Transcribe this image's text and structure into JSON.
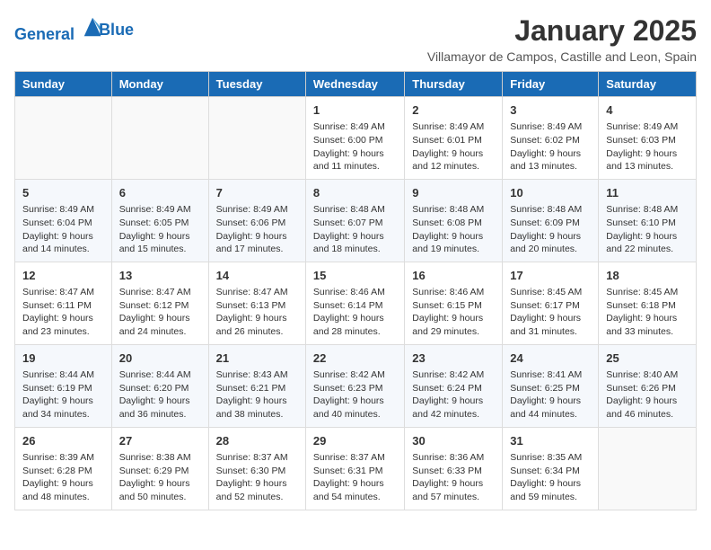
{
  "header": {
    "logo_line1": "General",
    "logo_line2": "Blue",
    "month_title": "January 2025",
    "subtitle": "Villamayor de Campos, Castille and Leon, Spain"
  },
  "days_of_week": [
    "Sunday",
    "Monday",
    "Tuesday",
    "Wednesday",
    "Thursday",
    "Friday",
    "Saturday"
  ],
  "weeks": [
    {
      "days": [
        {
          "num": "",
          "content": ""
        },
        {
          "num": "",
          "content": ""
        },
        {
          "num": "",
          "content": ""
        },
        {
          "num": "1",
          "content": "Sunrise: 8:49 AM\nSunset: 6:00 PM\nDaylight: 9 hours and 11 minutes."
        },
        {
          "num": "2",
          "content": "Sunrise: 8:49 AM\nSunset: 6:01 PM\nDaylight: 9 hours and 12 minutes."
        },
        {
          "num": "3",
          "content": "Sunrise: 8:49 AM\nSunset: 6:02 PM\nDaylight: 9 hours and 13 minutes."
        },
        {
          "num": "4",
          "content": "Sunrise: 8:49 AM\nSunset: 6:03 PM\nDaylight: 9 hours and 13 minutes."
        }
      ]
    },
    {
      "days": [
        {
          "num": "5",
          "content": "Sunrise: 8:49 AM\nSunset: 6:04 PM\nDaylight: 9 hours and 14 minutes."
        },
        {
          "num": "6",
          "content": "Sunrise: 8:49 AM\nSunset: 6:05 PM\nDaylight: 9 hours and 15 minutes."
        },
        {
          "num": "7",
          "content": "Sunrise: 8:49 AM\nSunset: 6:06 PM\nDaylight: 9 hours and 17 minutes."
        },
        {
          "num": "8",
          "content": "Sunrise: 8:48 AM\nSunset: 6:07 PM\nDaylight: 9 hours and 18 minutes."
        },
        {
          "num": "9",
          "content": "Sunrise: 8:48 AM\nSunset: 6:08 PM\nDaylight: 9 hours and 19 minutes."
        },
        {
          "num": "10",
          "content": "Sunrise: 8:48 AM\nSunset: 6:09 PM\nDaylight: 9 hours and 20 minutes."
        },
        {
          "num": "11",
          "content": "Sunrise: 8:48 AM\nSunset: 6:10 PM\nDaylight: 9 hours and 22 minutes."
        }
      ]
    },
    {
      "days": [
        {
          "num": "12",
          "content": "Sunrise: 8:47 AM\nSunset: 6:11 PM\nDaylight: 9 hours and 23 minutes."
        },
        {
          "num": "13",
          "content": "Sunrise: 8:47 AM\nSunset: 6:12 PM\nDaylight: 9 hours and 24 minutes."
        },
        {
          "num": "14",
          "content": "Sunrise: 8:47 AM\nSunset: 6:13 PM\nDaylight: 9 hours and 26 minutes."
        },
        {
          "num": "15",
          "content": "Sunrise: 8:46 AM\nSunset: 6:14 PM\nDaylight: 9 hours and 28 minutes."
        },
        {
          "num": "16",
          "content": "Sunrise: 8:46 AM\nSunset: 6:15 PM\nDaylight: 9 hours and 29 minutes."
        },
        {
          "num": "17",
          "content": "Sunrise: 8:45 AM\nSunset: 6:17 PM\nDaylight: 9 hours and 31 minutes."
        },
        {
          "num": "18",
          "content": "Sunrise: 8:45 AM\nSunset: 6:18 PM\nDaylight: 9 hours and 33 minutes."
        }
      ]
    },
    {
      "days": [
        {
          "num": "19",
          "content": "Sunrise: 8:44 AM\nSunset: 6:19 PM\nDaylight: 9 hours and 34 minutes."
        },
        {
          "num": "20",
          "content": "Sunrise: 8:44 AM\nSunset: 6:20 PM\nDaylight: 9 hours and 36 minutes."
        },
        {
          "num": "21",
          "content": "Sunrise: 8:43 AM\nSunset: 6:21 PM\nDaylight: 9 hours and 38 minutes."
        },
        {
          "num": "22",
          "content": "Sunrise: 8:42 AM\nSunset: 6:23 PM\nDaylight: 9 hours and 40 minutes."
        },
        {
          "num": "23",
          "content": "Sunrise: 8:42 AM\nSunset: 6:24 PM\nDaylight: 9 hours and 42 minutes."
        },
        {
          "num": "24",
          "content": "Sunrise: 8:41 AM\nSunset: 6:25 PM\nDaylight: 9 hours and 44 minutes."
        },
        {
          "num": "25",
          "content": "Sunrise: 8:40 AM\nSunset: 6:26 PM\nDaylight: 9 hours and 46 minutes."
        }
      ]
    },
    {
      "days": [
        {
          "num": "26",
          "content": "Sunrise: 8:39 AM\nSunset: 6:28 PM\nDaylight: 9 hours and 48 minutes."
        },
        {
          "num": "27",
          "content": "Sunrise: 8:38 AM\nSunset: 6:29 PM\nDaylight: 9 hours and 50 minutes."
        },
        {
          "num": "28",
          "content": "Sunrise: 8:37 AM\nSunset: 6:30 PM\nDaylight: 9 hours and 52 minutes."
        },
        {
          "num": "29",
          "content": "Sunrise: 8:37 AM\nSunset: 6:31 PM\nDaylight: 9 hours and 54 minutes."
        },
        {
          "num": "30",
          "content": "Sunrise: 8:36 AM\nSunset: 6:33 PM\nDaylight: 9 hours and 57 minutes."
        },
        {
          "num": "31",
          "content": "Sunrise: 8:35 AM\nSunset: 6:34 PM\nDaylight: 9 hours and 59 minutes."
        },
        {
          "num": "",
          "content": ""
        }
      ]
    }
  ]
}
